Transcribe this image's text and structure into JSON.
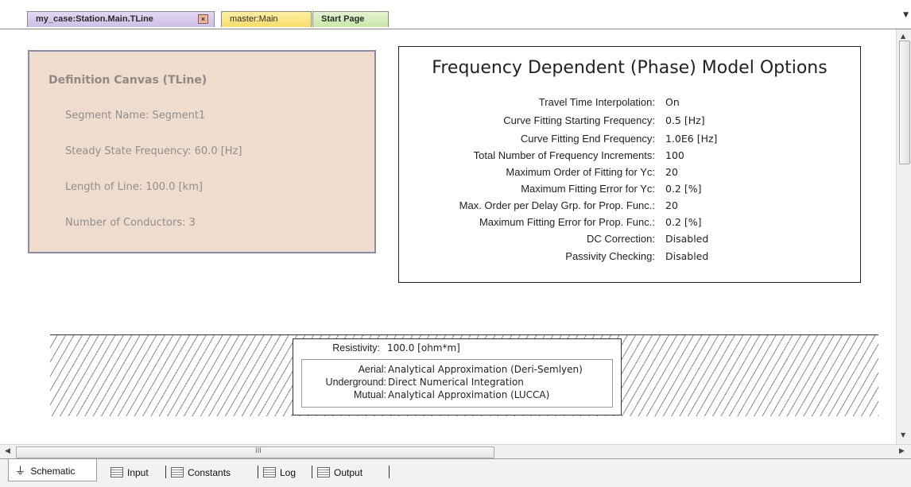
{
  "tabs": [
    {
      "label": "my_case:Station.Main.TLine",
      "close": "×"
    },
    {
      "label": "master:Main"
    },
    {
      "label": "Start Page"
    }
  ],
  "definition": {
    "title": "Definition Canvas (TLine)",
    "lines": [
      "Segment Name: Segment1",
      "Steady State Frequency: 60.0 [Hz]",
      "Length of Line: 100.0 [km]",
      "Number of Conductors: 3"
    ]
  },
  "fd_model": {
    "title": "Frequency Dependent (Phase) Model Options",
    "rows": [
      {
        "label": "Travel Time Interpolation:",
        "value": "On"
      },
      {
        "label": "Curve Fitting Starting Frequency:",
        "value": "0.5 [Hz]"
      },
      {
        "label": "Curve Fitting End Frequency:",
        "value": "1.0E6 [Hz]"
      },
      {
        "label": "Total Number of Frequency Increments:",
        "value": "100"
      },
      {
        "label": "Maximum Order of Fitting for Yc:",
        "value": "20"
      },
      {
        "label": "Maximum Fitting Error for Yc:",
        "value": "0.2 [%]"
      },
      {
        "label": "Max. Order per Delay Grp. for Prop. Func.:",
        "value": "20"
      },
      {
        "label": "Maximum Fitting Error for Prop. Func.:",
        "value": "0.2 [%]"
      },
      {
        "label": "DC Correction:",
        "value": "Disabled"
      },
      {
        "label": "Passivity Checking:",
        "value": "Disabled"
      }
    ]
  },
  "ground": {
    "resistivity_label": "Resistivity:",
    "resistivity_value": "100.0 [ohm*m]",
    "rows": [
      {
        "label": "Aerial:",
        "value": "Analytical Approximation (Deri-Semlyen)"
      },
      {
        "label": "Underground:",
        "value": "Direct Numerical Integration"
      },
      {
        "label": "Mutual:",
        "value": "Analytical Approximation (LUCCA)"
      }
    ]
  },
  "scroll": {
    "grip": "III"
  },
  "view_tabs": [
    "Schematic",
    "Input",
    "Constants",
    "Log",
    "Output"
  ]
}
